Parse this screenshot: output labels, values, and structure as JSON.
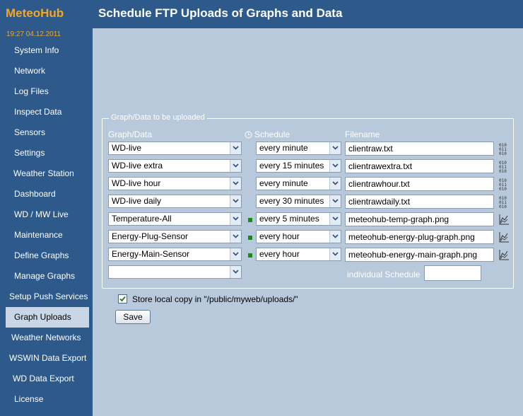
{
  "header": {
    "logo": "MeteoHub",
    "title": "Schedule FTP Uploads of Graphs and Data"
  },
  "sidebar": {
    "datetime": "19:27   04.12.2011",
    "items": [
      {
        "label": "System Info"
      },
      {
        "label": "Network"
      },
      {
        "label": "Log Files"
      },
      {
        "label": "Inspect Data"
      },
      {
        "label": "Sensors"
      },
      {
        "label": "Settings"
      },
      {
        "label": "Weather Station"
      },
      {
        "label": "Dashboard"
      },
      {
        "label": "WD / MW Live"
      },
      {
        "label": "Maintenance"
      },
      {
        "label": "Define Graphs"
      },
      {
        "label": "Manage Graphs"
      },
      {
        "label": "Setup Push Services"
      },
      {
        "label": "Graph Uploads",
        "active": true
      },
      {
        "label": "Weather Networks"
      },
      {
        "label": "WSWIN Data Export"
      },
      {
        "label": "WD Data Export"
      },
      {
        "label": "License"
      }
    ]
  },
  "upload": {
    "legend": "Graph/Data to be uploaded",
    "col_graph": "Graph/Data",
    "col_schedule": "Schedule",
    "col_filename": "Filename",
    "rows": [
      {
        "graph": "WD-live",
        "schedule": "every minute",
        "filename": "clientraw.txt",
        "marker": false,
        "icon": "binary-data-icon"
      },
      {
        "graph": "WD-live extra",
        "schedule": "every 15 minutes",
        "filename": "clientrawextra.txt",
        "marker": false,
        "icon": "binary-data-icon"
      },
      {
        "graph": "WD-live hour",
        "schedule": "every minute",
        "filename": "clientrawhour.txt",
        "marker": false,
        "icon": "binary-data-icon"
      },
      {
        "graph": "WD-live daily",
        "schedule": "every 30 minutes",
        "filename": "clientrawdaily.txt",
        "marker": false,
        "icon": "binary-data-icon"
      },
      {
        "graph": "Temperature-All",
        "schedule": "every 5 minutes",
        "filename": "meteohub-temp-graph.png",
        "marker": true,
        "icon": "graph-icon"
      },
      {
        "graph": "Energy-Plug-Sensor",
        "schedule": "every hour",
        "filename": "meteohub-energy-plug-graph.png",
        "marker": true,
        "icon": "graph-icon"
      },
      {
        "graph": "Energy-Main-Sensor",
        "schedule": "every hour",
        "filename": "meteohub-energy-main-graph.png",
        "marker": true,
        "icon": "graph-icon"
      }
    ],
    "empty_graph": "",
    "individual_schedule_label": "individual Schedule",
    "individual_schedule_value": ""
  },
  "store_local": {
    "checked": true,
    "label": "Store local copy in \"/public/myweb/uploads/\""
  },
  "save_label": "Save"
}
